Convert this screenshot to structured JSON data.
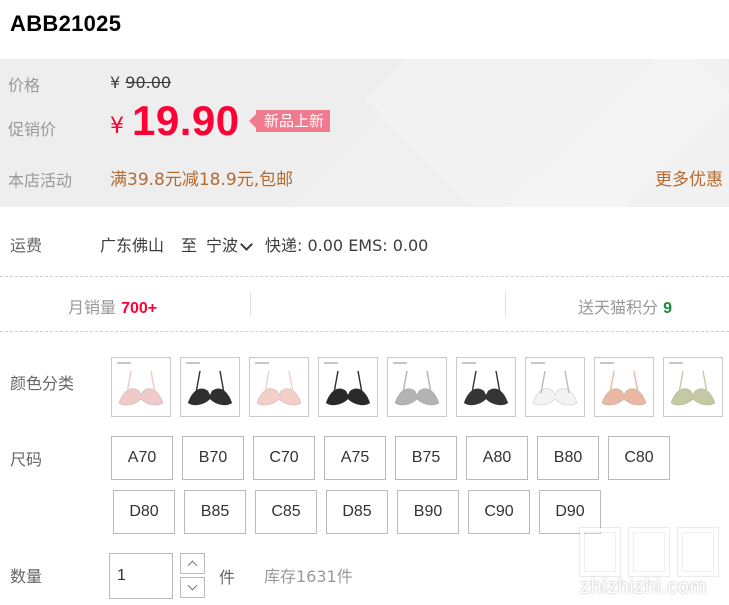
{
  "product": {
    "code": "ABB21025"
  },
  "price": {
    "original_label": "价格",
    "original_currency": "¥",
    "original_value": "90.00",
    "promo_label": "促销价",
    "promo_currency": "¥",
    "promo_value": "19.90",
    "badge": "新品上新",
    "activity_label": "本店活动",
    "activity_text": "满39.8元减18.9元,包邮",
    "more_link": "更多优惠"
  },
  "shipping": {
    "label": "运费",
    "from": "广东佛山",
    "to_word": "至",
    "destination": "宁波",
    "fees": "快递: 0.00 EMS: 0.00"
  },
  "stats": {
    "sales_label": "月销量",
    "sales_value": "700+",
    "points_label": "送天猫积分",
    "points_value": "9"
  },
  "colors": {
    "label": "颜色分类",
    "swatches": [
      "#f0c9c9",
      "#2f2f2f",
      "#f4cfc8",
      "#2a2a2a",
      "#b3b3b3",
      "#353535",
      "#f3f3f3",
      "#e8b8a5",
      "#c4c9a4"
    ]
  },
  "sizes": {
    "label": "尺码",
    "options": [
      "A70",
      "B70",
      "C70",
      "A75",
      "B75",
      "A80",
      "B80",
      "C80",
      "D80",
      "B85",
      "C85",
      "D85",
      "B90",
      "C90",
      "D90"
    ]
  },
  "quantity": {
    "label": "数量",
    "value": "1",
    "unit": "件",
    "stock": "库存1631件"
  },
  "watermark": {
    "text": "zhizhizhi.com"
  }
}
